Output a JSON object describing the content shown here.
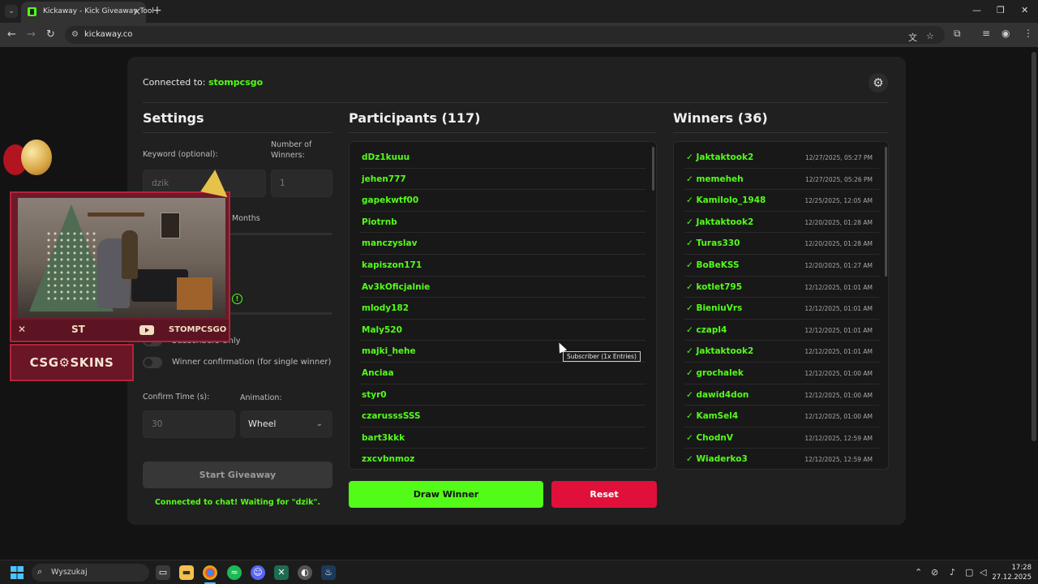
{
  "browser": {
    "tab_title": "Kickaway - Kick Giveaway Tool",
    "url": "kickaway.co",
    "accent": "#53fc18"
  },
  "app": {
    "connected_label": "Connected to:",
    "channel": "stompcsgo",
    "settings": {
      "title": "Settings",
      "keyword_label": "Keyword (optional):",
      "keyword_value": "dzik",
      "winners_label": "Number of Winners:",
      "winners_value": "1",
      "months_label": "Months",
      "subscribers_only": "Subscribers Only",
      "winner_confirmation": "Winner confirmation (for single winner)",
      "confirm_time_label": "Confirm Time (s):",
      "confirm_time_value": "30",
      "animation_label": "Animation:",
      "animation_value": "Wheel",
      "start_button": "Start Giveaway",
      "status": "Connected to chat! Waiting for \"dzik\"."
    },
    "participants": {
      "title": "Participants (117)",
      "items": [
        "dDz1kuuu",
        "jehen777",
        "gapekwtf00",
        "Piotrnb",
        "manczyslav",
        "kapiszon171",
        "Av3kOficjalnie",
        "mlody182",
        "Maly520",
        "majki_hehe",
        "Anciaa",
        "styr0",
        "czarusssSSS",
        "bart3kkk",
        "zxcvbnmoz"
      ],
      "tooltip": "Subscriber (1x Entries)"
    },
    "winners": {
      "title": "Winners (36)",
      "items": [
        {
          "name": "✓ Jaktaktook2",
          "time": "12/27/2025, 05:27 PM"
        },
        {
          "name": "✓ memeheh",
          "time": "12/27/2025, 05:26 PM"
        },
        {
          "name": "✓ Kamilolo_1948",
          "time": "12/25/2025, 12:05 AM"
        },
        {
          "name": "✓ Jaktaktook2",
          "time": "12/20/2025, 01:28 AM"
        },
        {
          "name": "✓ Turas330",
          "time": "12/20/2025, 01:28 AM"
        },
        {
          "name": "✓ BoBeKSS",
          "time": "12/20/2025, 01:27 AM"
        },
        {
          "name": "✓ kotlet795",
          "time": "12/12/2025, 01:01 AM"
        },
        {
          "name": "✓ BieniuVrs",
          "time": "12/12/2025, 01:01 AM"
        },
        {
          "name": "✓ czapl4",
          "time": "12/12/2025, 01:01 AM"
        },
        {
          "name": "✓ Jaktaktook2",
          "time": "12/12/2025, 01:01 AM"
        },
        {
          "name": "✓ grochalek",
          "time": "12/12/2025, 01:00 AM"
        },
        {
          "name": "✓ dawid4don",
          "time": "12/12/2025, 01:00 AM"
        },
        {
          "name": "✓ KamSel4",
          "time": "12/12/2025, 01:00 AM"
        },
        {
          "name": "✓ ChodnV",
          "time": "12/12/2025, 12:59 AM"
        },
        {
          "name": "✓ Wiaderko3",
          "time": "12/12/2025, 12:59 AM"
        }
      ]
    },
    "draw_button": "Draw Winner",
    "reset_button": "Reset",
    "draw_color": "#53fc18",
    "reset_color": "#e0103a"
  },
  "overlay": {
    "sponsor_text": "CSG⚙SKINS",
    "bar_logo_left": "ЅТ",
    "bar_logo_right": "STOMPCSGO"
  },
  "taskbar": {
    "search_placeholder": "Wyszukaj",
    "time": "17:28",
    "date": "27.12.2025"
  }
}
